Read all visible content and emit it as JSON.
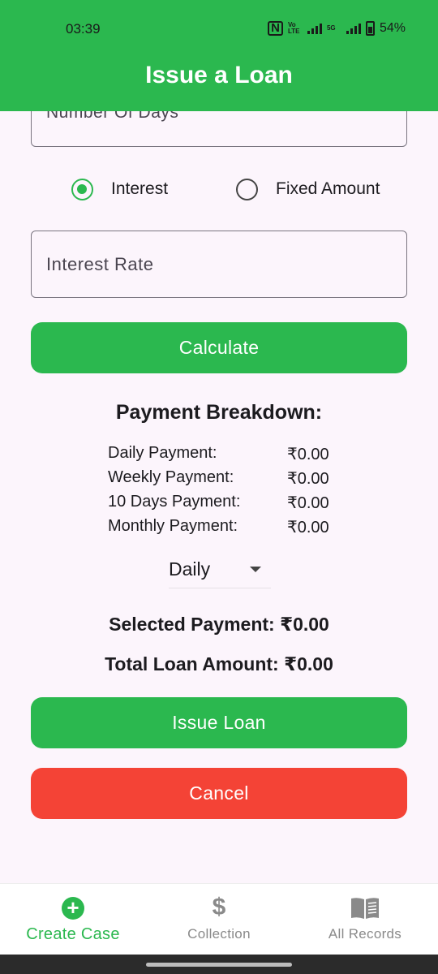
{
  "status_bar": {
    "time": "03:39",
    "battery": "54%",
    "network_label": "5G"
  },
  "app_bar": {
    "title": "Issue a Loan"
  },
  "form": {
    "days_field_label": "Number Of Days",
    "interest_option": "Interest",
    "fixed_option": "Fixed Amount",
    "selected_mode": "Interest",
    "interest_rate_placeholder": "Interest Rate",
    "calculate_label": "Calculate"
  },
  "breakdown": {
    "title": "Payment Breakdown:",
    "rows": [
      {
        "label": "Daily Payment:",
        "value": "₹0.00"
      },
      {
        "label": "Weekly Payment:",
        "value": "₹0.00"
      },
      {
        "label": "10 Days Payment:",
        "value": "₹0.00"
      },
      {
        "label": "Monthly Payment:",
        "value": "₹0.00"
      }
    ]
  },
  "frequency_select": {
    "selected": "Daily"
  },
  "summary": {
    "selected_payment": "Selected Payment: ₹0.00",
    "total_loan_amount": "Total Loan Amount: ₹0.00"
  },
  "actions": {
    "issue_label": "Issue Loan",
    "cancel_label": "Cancel"
  },
  "bottom_nav": {
    "items": [
      {
        "label": "Create Case",
        "icon": "add-circle-icon",
        "active": true
      },
      {
        "label": "Collection",
        "icon": "dollar-icon",
        "active": false
      },
      {
        "label": "All Records",
        "icon": "book-icon",
        "active": false
      }
    ]
  },
  "colors": {
    "primary": "#2bb84f",
    "danger": "#f44336",
    "background": "#fcf5fc"
  }
}
